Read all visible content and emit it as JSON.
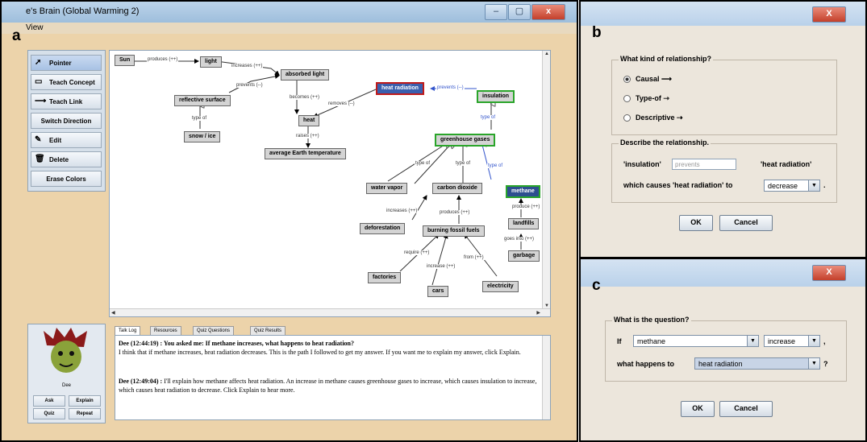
{
  "panel_labels": {
    "a": "a",
    "b": "b",
    "c": "c"
  },
  "main_window": {
    "title": "e's Brain (Global Warming 2)",
    "menu": "View",
    "toolbar": [
      {
        "label": "Pointer",
        "icon": "arrow-pointer-icon"
      },
      {
        "label": "Teach Concept",
        "icon": "concept-icon"
      },
      {
        "label": "Teach Link",
        "icon": "link-icon"
      },
      {
        "label": "Switch Direction",
        "icon": ""
      },
      {
        "label": "Edit",
        "icon": "edit-icon"
      },
      {
        "label": "Delete",
        "icon": "trash-icon"
      },
      {
        "label": "Erase Colors",
        "icon": ""
      }
    ],
    "concept_map": {
      "nodes": {
        "sun": "Sun",
        "light": "light",
        "absorbed_light": "absorbed light",
        "heat_radiation": "heat radiation",
        "insulation": "insulation",
        "reflective_surface": "reflective surface",
        "heat": "heat",
        "snow_ice": "snow / ice",
        "avg_earth_temp": "average Earth temperature",
        "greenhouse_gases": "greenhouse gases",
        "water_vapor": "water vapor",
        "carbon_dioxide": "carbon dioxide",
        "methane": "methane",
        "deforestation": "deforestation",
        "burning_fossil_fuels": "burning fossil fuels",
        "landfills": "landfills",
        "garbage": "garbage",
        "factories": "factories",
        "cars": "cars",
        "electricity": "electricity"
      },
      "edges": {
        "produces": "produces (++)",
        "increases": "increases (++)",
        "prevents_refl": "prevents (--)",
        "becomes": "becomes (++)",
        "removes": "removes (--)",
        "prevents_ins": "prevents (--)",
        "type_of_snow": "type of",
        "raises": "raises (++)",
        "type_of_ins": "type of",
        "type_of_wv": "type of",
        "type_of_co2": "type of",
        "type_of_meth": "type of",
        "increases_def": "increases (++)",
        "produces_bff": "produces (++)",
        "produce_land": "produce (++)",
        "goes_into": "goes into (++)",
        "require": "require (++)",
        "increase_cars": "increase (++)",
        "from": "from (++)"
      }
    },
    "agent": {
      "name": "Dee",
      "buttons": [
        "Ask",
        "Explain",
        "Quiz",
        "Repeat"
      ]
    },
    "tabs": [
      "Talk Log",
      "Resources",
      "Quiz Questions",
      "Quiz Results"
    ],
    "talk_log": [
      {
        "head": "Dee (12:44:19) : You asked me: If methane increases, what happens to heat radiation?",
        "body": "I think that if methane increases, heat radiation decreases. This is the path I followed to get my answer. If you want me to explain my answer, click Explain."
      },
      {
        "head": "Dee (12:49:04) :",
        "body": "I'll explain how methane affects heat radiation. An increase in methane causes greenhouse gases to increase, which causes insulation to increase, which causes heat radiation to decrease. Click Explain to hear more."
      }
    ]
  },
  "dialog_b": {
    "close": "X",
    "group1_title": "What kind of relationship?",
    "options": [
      "Causal",
      "Type-of",
      "Descriptive"
    ],
    "group2_title": "Describe the relationship.",
    "from": "'insulation'",
    "relation_value": "prevents",
    "to": "'heat radiation'",
    "causes_text": "which causes 'heat radiation' to",
    "effect_value": "decrease",
    "period": ".",
    "ok": "OK",
    "cancel": "Cancel"
  },
  "dialog_c": {
    "close": "X",
    "group_title": "What is the question?",
    "if_label": "If",
    "subject_value": "methane",
    "change_value": "increase",
    "comma": ",",
    "what_label": "what happens to",
    "target_value": "heat radiation",
    "qmark": "?",
    "ok": "OK",
    "cancel": "Cancel"
  }
}
